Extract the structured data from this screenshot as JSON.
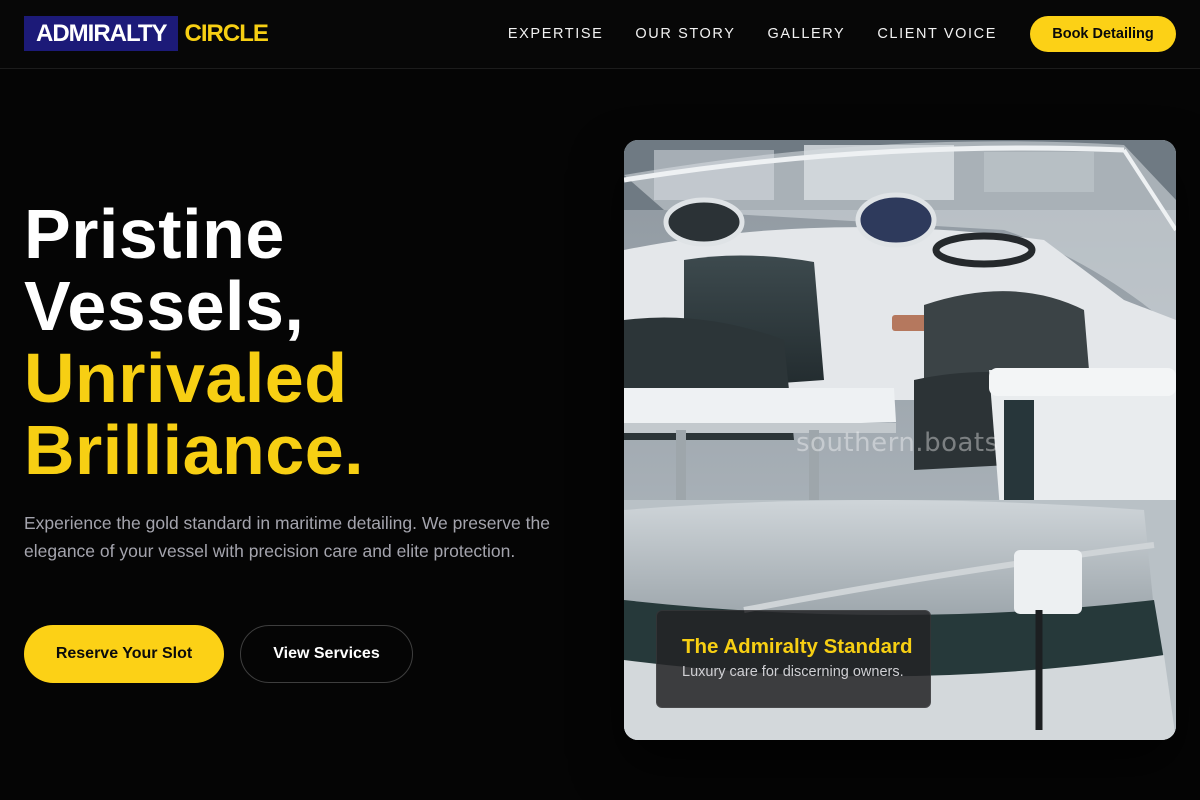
{
  "brand": {
    "name_primary": "ADMIRALTY",
    "name_accent": "CIRCLE",
    "colors": {
      "primary_block": "#1c1a78",
      "accent": "#f7cf13"
    }
  },
  "nav": {
    "items": [
      {
        "label": "EXPERTISE"
      },
      {
        "label": "OUR STORY"
      },
      {
        "label": "GALLERY"
      },
      {
        "label": "CLIENT VOICE"
      }
    ],
    "cta_label": "Book Detailing"
  },
  "hero": {
    "title_lines": [
      "Pristine",
      "Vessels,"
    ],
    "accent_lines": [
      "Unrivaled",
      "Brilliance."
    ],
    "subtitle": "Experience the gold standard in maritime detailing. We preserve the elegance of your vessel with precision care and elite protection.",
    "primary_button": "Reserve Your Slot",
    "secondary_button": "View Services"
  },
  "image": {
    "subject": "boat-cockpit-photo",
    "watermark": "southern.boats",
    "caption_title": "The Admiralty Standard",
    "caption_text": "Luxury care for discerning owners."
  }
}
